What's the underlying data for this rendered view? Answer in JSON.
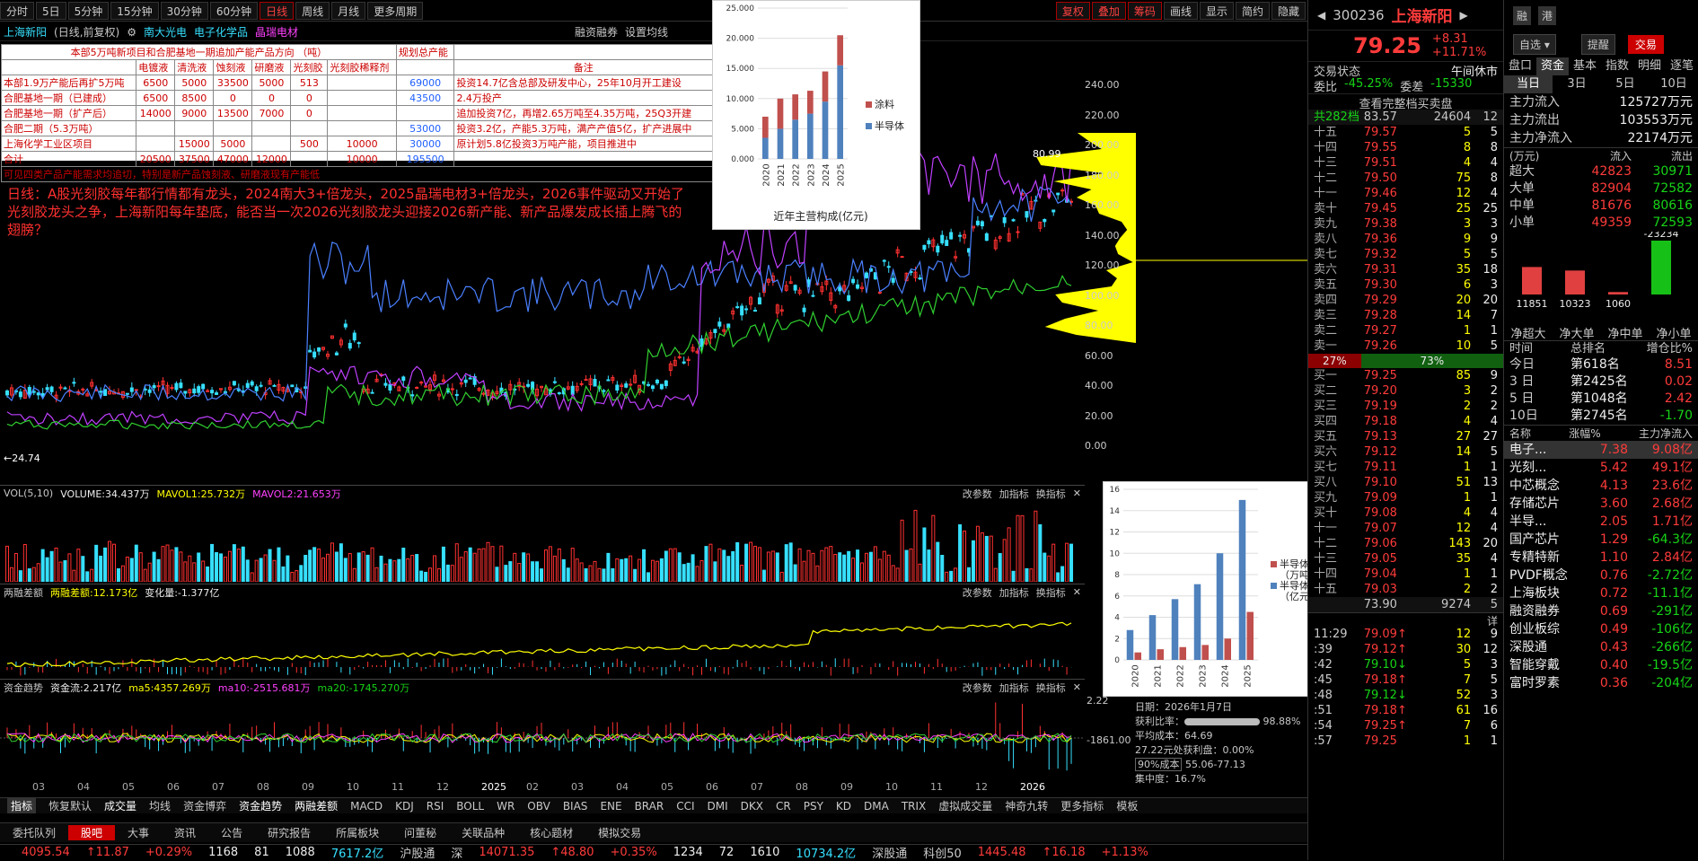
{
  "toolbar": {
    "periods": [
      "分时",
      "5日",
      "5分钟",
      "15分钟",
      "30分钟",
      "60分钟",
      "日线",
      "周线",
      "月线",
      "更多周期"
    ],
    "active": "日线",
    "right_buttons": [
      "复权",
      "叠加",
      "筹码",
      "画线",
      "显示",
      "简约",
      "隐藏"
    ]
  },
  "stock_title": {
    "name": "上海新阳",
    "mode": "(日线,前复权)",
    "overlays": [
      "南大光电",
      "电子化学品",
      "晶瑞电材"
    ],
    "top_links": [
      "融资融券",
      "设置均线"
    ]
  },
  "table": {
    "title": "本部5万吨新项目和合肥基地一期追加产能产品方向 （吨）",
    "title2": "规划总产能",
    "headers": [
      "",
      "电镀液",
      "清洗液",
      "蚀刻液",
      "研磨液",
      "光刻胶",
      "光刻胶稀释剂",
      "",
      "备注"
    ],
    "rows": [
      [
        "本部1.9万产能后再扩5万吨",
        "6500",
        "5000",
        "33500",
        "5000",
        "513",
        "",
        "69000",
        "投资14.7亿含总部及研发中心，25年10月开工建设"
      ],
      [
        "合肥基地一期（已建成）",
        "6500",
        "8500",
        "0",
        "0",
        "0",
        "",
        "43500",
        "2.4万投产"
      ],
      [
        "合肥基地一期（扩产后）",
        "14000",
        "9000",
        "13500",
        "7000",
        "0",
        "",
        "",
        "追加投资7亿，再增2.65万吨至4.35万吨，25Q3开建"
      ],
      [
        "合肥二期（5.3万吨）",
        "",
        "",
        "",
        "",
        "",
        "",
        "53000",
        "投资3.2亿，产能5.3万吨，满产产值5亿，扩产进展中"
      ],
      [
        "上海化学工业区项目",
        "",
        "15000",
        "5000",
        "",
        "500",
        "10000",
        "30000",
        "原计划5.8亿投资3万吨产能，项目推进中"
      ],
      [
        "合计",
        "20500",
        "37500",
        "47000",
        "12000",
        "",
        "10000",
        "195500",
        ""
      ]
    ],
    "footer": "可见四类产品产能需求均追切，特别是新产品蚀刻液、研磨液现有产能低"
  },
  "annotation": "日线：A股光刻胶每年都行情都有龙头，2024南大3+倍龙头，2025晶瑞电材3+倍龙头，2026事件驱动又开始了光刻胶龙头之争，上海新阳每年垫底，能否当一次2026光刻胶龙头迎接2026新产能、新产品爆发成长插上腾飞的翅膀？",
  "chart_data": [
    {
      "type": "bar",
      "title": "近年主营构成(亿元)",
      "categories": [
        "2020",
        "2021",
        "2022",
        "2023",
        "2024",
        "2025"
      ],
      "ylim": [
        0,
        25
      ],
      "yticks": [
        "25.000",
        "20.000",
        "15.000",
        "10.000",
        "5.000",
        "0.000"
      ],
      "series": [
        {
          "name": "半导体",
          "values": [
            3.5,
            5,
            6.5,
            7.5,
            9.5,
            15.5
          ],
          "color": "#4f81bd"
        },
        {
          "name": "涂料",
          "values": [
            3.5,
            5,
            4.2,
            3.8,
            5,
            5
          ],
          "color": "#c0504d"
        }
      ]
    },
    {
      "type": "bar",
      "categories": [
        "2020",
        "2021",
        "2022",
        "2023",
        "2024",
        "2025"
      ],
      "ylim": [
        0,
        16
      ],
      "yticks": [
        "16",
        "14",
        "12",
        "10",
        "8",
        "6",
        "4",
        "2",
        "0"
      ],
      "series": [
        {
          "name": "半导体化学品营收（亿元）",
          "values": [
            2.8,
            4.2,
            5.7,
            7.1,
            10,
            15
          ],
          "color": "#4f81bd"
        },
        {
          "name": "半导体化学品产出（万吨）",
          "values": [
            0.7,
            1,
            1.2,
            1.4,
            2,
            4.5
          ],
          "color": "#c0504d"
        }
      ]
    }
  ],
  "price_axis": [
    "240.00",
    "220.00",
    "200.00",
    "180.00",
    "160.00",
    "140.00",
    "120.00",
    "100.00",
    "80.00",
    "60.00",
    "40.00",
    "20.00",
    "0.00"
  ],
  "price_labels": {
    "high": "80.99",
    "low": "24.74"
  },
  "date_axis": [
    "03",
    "04",
    "05",
    "06",
    "07",
    "08",
    "09",
    "10",
    "11",
    "12",
    "2025",
    "02",
    "03",
    "04",
    "05",
    "06",
    "07",
    "08",
    "09",
    "10",
    "11",
    "12",
    "2026"
  ],
  "vol_panel": {
    "label": "VOL(5,10)",
    "volume": "VOLUME:34.437万",
    "ma1": "MAVOL1:25.732万",
    "ma2": "MAVOL2:21.653万",
    "buttons": [
      "改参数",
      "加指标",
      "换指标"
    ]
  },
  "margin_panel": {
    "label": "两融差额",
    "val": "两融差额:12.173亿",
    "chg": "变化量:-1.377亿"
  },
  "fund_panel": {
    "label": "资金趋势",
    "val": "资金流:2.217亿",
    "ma5": "ma5:4357.269万",
    "ma10": "ma10:-2515.681万",
    "ma20": "ma20:-1745.270万",
    "right_value": "-1861.00",
    "right_value2": "2.22"
  },
  "chip_info": {
    "date": "日期：2026年1月7日",
    "ratio_label": "获利比率：",
    "ratio": "98.88%",
    "avg": "平均成本：64.69",
    "profit": "27.22元处获利盘：0.00%",
    "cost_label": "90%成本",
    "cost": "55.06-77.13",
    "conc": "集中度：16.7%"
  },
  "indicator_tabs": [
    "指标",
    "恢复默认",
    "成交量",
    "均线",
    "资金博弈",
    "资金趋势",
    "两融差额",
    "MACD",
    "KDJ",
    "RSI",
    "BOLL",
    "WR",
    "OBV",
    "BIAS",
    "ENE",
    "BRAR",
    "CCI",
    "DMI",
    "DKX",
    "CR",
    "PSY",
    "KD",
    "DMA",
    "TRIX",
    "虚拟成交量",
    "神奇九转",
    "更多指标",
    "模板"
  ],
  "bottom_tabs": [
    "委托队列",
    "股吧",
    "大事",
    "资讯",
    "公告",
    "研究报告",
    "所属板块",
    "问董秘",
    "关联品种",
    "核心题材",
    "模拟交易"
  ],
  "status": [
    "4095.54",
    "↑11.87",
    "+0.29%",
    "1168",
    "81",
    "1088",
    "7617.2亿",
    "沪股通",
    "深",
    "14071.35",
    "↑48.80",
    "+0.35%",
    "1234",
    "72",
    "1610",
    "10734.2亿",
    "深股通",
    "科创50",
    "1445.48",
    "↑16.18",
    "+1.13%"
  ],
  "quote": {
    "code": "300236",
    "name": "上海新阳",
    "price": "79.25",
    "chg": "+8.31",
    "pct": "+11.71%",
    "state_label": "交易状态",
    "state": "午间休市",
    "wb_label": "委比",
    "wb": "-45.25%",
    "wc_label": "委差",
    "wc": "-15330",
    "full_book": "查看完整档买卖盘",
    "total_label": "共282档",
    "total_price": "83.57",
    "total_vol": "24604",
    "total_n": "12"
  },
  "asks": [
    [
      "十五",
      "79.57",
      "5",
      "5"
    ],
    [
      "十四",
      "79.55",
      "8",
      "8"
    ],
    [
      "十三",
      "79.51",
      "4",
      "4"
    ],
    [
      "十二",
      "79.50",
      "75",
      "8"
    ],
    [
      "十一",
      "79.46",
      "12",
      "4"
    ],
    [
      "卖十",
      "79.45",
      "25",
      "25"
    ],
    [
      "卖九",
      "79.38",
      "3",
      "3"
    ],
    [
      "卖八",
      "79.36",
      "9",
      "9"
    ],
    [
      "卖七",
      "79.32",
      "5",
      "5"
    ],
    [
      "卖六",
      "79.31",
      "35",
      "18"
    ],
    [
      "卖五",
      "79.30",
      "6",
      "3"
    ],
    [
      "卖四",
      "79.29",
      "20",
      "20"
    ],
    [
      "卖三",
      "79.28",
      "14",
      "7"
    ],
    [
      "卖二",
      "79.27",
      "1",
      "1"
    ],
    [
      "卖一",
      "79.26",
      "10",
      "5"
    ]
  ],
  "ratio": {
    "left": "27%",
    "right": "73%"
  },
  "bids": [
    [
      "买一",
      "79.25",
      "85",
      "9"
    ],
    [
      "买二",
      "79.20",
      "3",
      "2"
    ],
    [
      "买三",
      "79.19",
      "2",
      "2"
    ],
    [
      "买四",
      "79.18",
      "4",
      "4"
    ],
    [
      "买五",
      "79.13",
      "27",
      "27"
    ],
    [
      "买六",
      "79.12",
      "14",
      "5"
    ],
    [
      "买七",
      "79.11",
      "1",
      "1"
    ],
    [
      "买八",
      "79.10",
      "51",
      "13"
    ],
    [
      "买九",
      "79.09",
      "1",
      "1"
    ],
    [
      "买十",
      "79.08",
      "4",
      "4"
    ],
    [
      "十一",
      "79.07",
      "12",
      "4"
    ],
    [
      "十二",
      "79.06",
      "143",
      "20"
    ],
    [
      "十三",
      "79.05",
      "35",
      "4"
    ],
    [
      "十四",
      "79.04",
      "1",
      "1"
    ],
    [
      "十五",
      "79.03",
      "2",
      "2"
    ]
  ],
  "bid_total": {
    "price": "73.90",
    "vol": "9274",
    "n": "5"
  },
  "ticks": [
    [
      "11:29",
      "79.09↑",
      "12",
      "9"
    ],
    [
      ":39",
      "79.12↑",
      "30",
      "12"
    ],
    [
      ":42",
      "79.10↓",
      "5",
      "3"
    ],
    [
      ":45",
      "79.18↑",
      "7",
      "5"
    ],
    [
      ":48",
      "79.12↓",
      "52",
      "3"
    ],
    [
      ":51",
      "79.18↑",
      "61",
      "16"
    ],
    [
      ":54",
      "79.25↑",
      "7",
      "6"
    ],
    [
      ":57",
      "79.25",
      "1",
      "1"
    ]
  ],
  "far_right": {
    "buttons": [
      "融",
      "港"
    ],
    "select": "自选 ▾",
    "remind": "提醒",
    "trade": "交易",
    "tabs": [
      "盘口",
      "资金",
      "基本",
      "指数",
      "明细",
      "逐笔"
    ],
    "periods": [
      "当日",
      "3日",
      "5日",
      "10日"
    ],
    "flows": [
      [
        "主力流入",
        "125727万元"
      ],
      [
        "主力流出",
        "103553万元"
      ],
      [
        "主力净流入",
        "22174万元"
      ]
    ],
    "flow_head": [
      "(万元)",
      "流入",
      "流出"
    ],
    "flow_rows": [
      [
        "超大",
        "42823",
        "30971"
      ],
      [
        "大单",
        "82904",
        "72582"
      ],
      [
        "中单",
        "81676",
        "80616"
      ],
      [
        "小单",
        "49359",
        "72593"
      ]
    ],
    "net_vals": [
      "11851",
      "10323",
      "1060",
      "-23234"
    ],
    "net_labels": [
      "净超大",
      "净大单",
      "净中单",
      "净小单"
    ],
    "rank_head": [
      "时间",
      "总排名",
      "增仓比%"
    ],
    "ranks": [
      [
        "今日",
        "第618名",
        "8.51"
      ],
      [
        "3 日",
        "第2425名",
        "0.02"
      ],
      [
        "5 日",
        "第1048名",
        "2.42"
      ],
      [
        "10日",
        "第2745名",
        "-1.70"
      ]
    ],
    "sector_head": [
      "名称",
      "涨幅%",
      "主力净流入"
    ],
    "sectors": [
      [
        "电子...",
        "7.38",
        "9.08亿"
      ],
      [
        "光刻...",
        "5.42",
        "49.1亿"
      ],
      [
        "中芯概念",
        "4.13",
        "23.6亿"
      ],
      [
        "存储芯片",
        "3.60",
        "2.68亿"
      ],
      [
        "半导...",
        "2.05",
        "1.71亿"
      ],
      [
        "国产芯片",
        "1.29",
        "-64.3亿"
      ],
      [
        "专精特新",
        "1.10",
        "2.84亿"
      ],
      [
        "PVDF概念",
        "0.76",
        "-2.72亿"
      ],
      [
        "上海板块",
        "0.72",
        "-11.1亿"
      ],
      [
        "融资融券",
        "0.69",
        "-291亿"
      ],
      [
        "创业板综",
        "0.49",
        "-106亿"
      ],
      [
        "深股通",
        "0.43",
        "-266亿"
      ],
      [
        "智能穿戴",
        "0.40",
        "-19.5亿"
      ],
      [
        "富时罗素",
        "0.36",
        "-204亿"
      ]
    ]
  }
}
